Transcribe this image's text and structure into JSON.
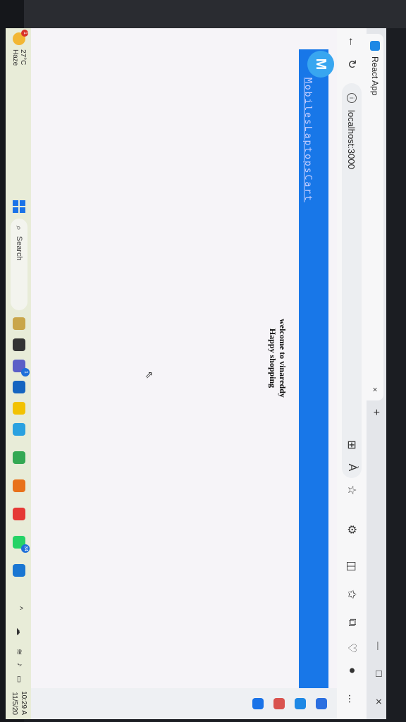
{
  "browser": {
    "tab_title": "React App",
    "tab_close": "×",
    "new_tab": "+",
    "window_controls": [
      "—",
      "☐",
      "✕"
    ],
    "back_icon": "←",
    "refresh_icon": "↻",
    "info_icon": "i",
    "url": "localhost:3000",
    "toolbar_icons": [
      "grid-icon",
      "read-aloud-icon",
      "star-icon",
      "extensions-icon",
      "split-screen-icon",
      "favorites-icon",
      "collections-icon",
      "browser-essentials-icon",
      "profile-icon",
      "more-icon"
    ],
    "read_aloud_label": "À",
    "more_label": "..."
  },
  "page": {
    "brand": "MobilesLaptopsCart",
    "logo_glyph": "M",
    "welcome_line1": "welcome to vinareddy",
    "welcome_line2": "Happy shopping",
    "accent_color": "#1877e8"
  },
  "taskbar": {
    "weather_temp": "27°C",
    "weather_desc": "Haze",
    "weather_badge": "1",
    "search_label": "Search",
    "apps": [
      "file-explorer",
      "teams",
      "vscode-like",
      "files",
      "edge",
      "chrome",
      "sublime",
      "youtube",
      "whatsapp",
      "vscode"
    ],
    "teams_badge": "1",
    "whatsapp_badge": "34",
    "tray_chevron": "^",
    "time": "10:29 A",
    "date": "11/5/20"
  }
}
